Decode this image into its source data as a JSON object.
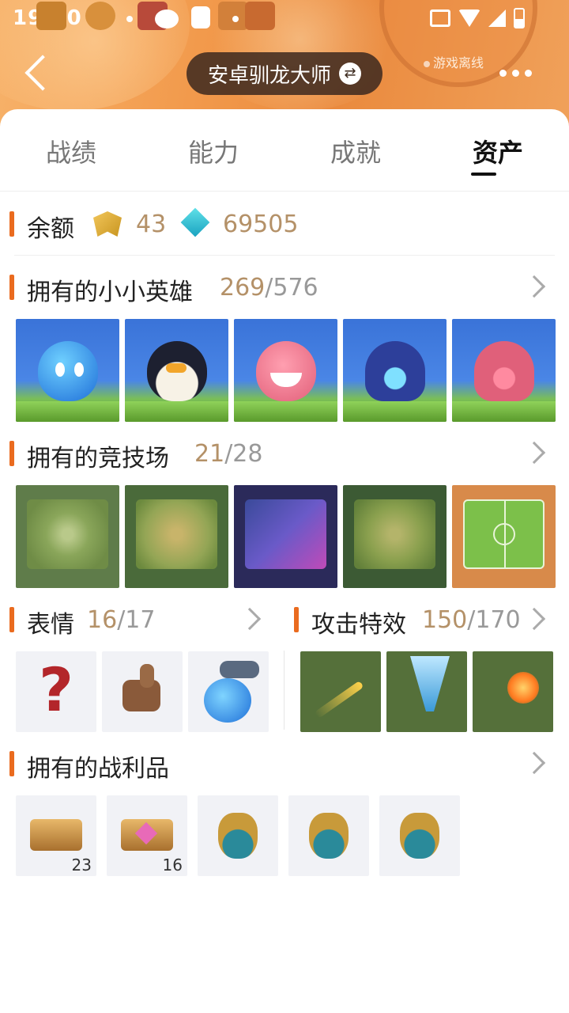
{
  "status_bar": {
    "time": "19:30"
  },
  "header": {
    "title": "安卓驯龙大师",
    "offline": "游戏离线",
    "colors": {
      "bg": "#f29a4c",
      "pill": "#3c2a1e"
    }
  },
  "tabs": [
    {
      "label": "战绩",
      "active": false
    },
    {
      "label": "能力",
      "active": false
    },
    {
      "label": "成就",
      "active": false
    },
    {
      "label": "资产",
      "active": true
    }
  ],
  "balance": {
    "label": "余额",
    "crest_icon": "crest-coin-icon",
    "crest_value": "43",
    "gem_icon": "gem-icon",
    "gem_value": "69505"
  },
  "heroes": {
    "title": "拥有的小小英雄",
    "owned": "269",
    "total": "/576",
    "items": [
      "blue-spirit",
      "penguin",
      "pink-cat",
      "blue-hooded-spirit",
      "pink-hooded-spirit"
    ]
  },
  "arenas": {
    "title": "拥有的竞技场",
    "owned": "21",
    "total": "/28",
    "items": [
      "grass-arena",
      "jungle-arena",
      "neon-arena",
      "forest-arena",
      "soccer-arena"
    ]
  },
  "emotes": {
    "title": "表情",
    "owned": "16",
    "total": "/17",
    "items": [
      "question-mark",
      "thumbs-up",
      "cannon-spirit"
    ]
  },
  "attack_effects": {
    "title": "攻击特效",
    "owned": "150",
    "total": "/170",
    "items": [
      "golden-bolt",
      "tornado",
      "fireball"
    ]
  },
  "loot": {
    "title": "拥有的战利品",
    "items": [
      {
        "icon": "rank-x2-gold",
        "count": "23"
      },
      {
        "icon": "rank-x2-pink",
        "count": "16"
      },
      {
        "icon": "loot-bag",
        "count": ""
      },
      {
        "icon": "loot-bag",
        "count": ""
      },
      {
        "icon": "loot-bag",
        "count": ""
      }
    ]
  },
  "accent_color": "#ea6b1f",
  "count_color": "#b49168"
}
